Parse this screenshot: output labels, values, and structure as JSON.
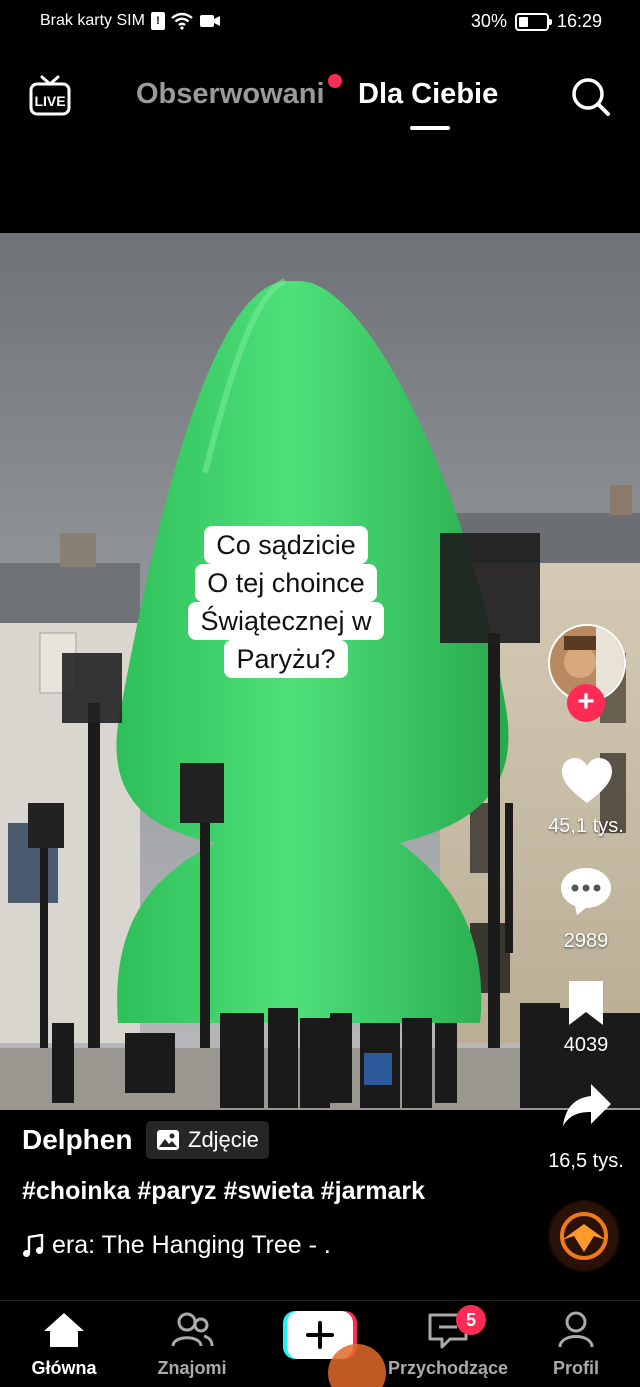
{
  "status_bar": {
    "carrier": "Brak karty SIM",
    "battery": "30%",
    "time": "16:29"
  },
  "top_nav": {
    "live_label": "LIVE",
    "tab_following": "Obserwowani",
    "tab_for_you": "Dla Ciebie"
  },
  "post": {
    "caption_lines": [
      "Co sądzicie",
      "O tej choince",
      "Świątecznej w",
      "Paryżu?"
    ],
    "likes": "45,1 tys.",
    "comments": "2989",
    "saves": "4039",
    "shares": "16,5 tys.",
    "author": "Delphen",
    "type_label": "Zdjęcie",
    "hashtags": "#choinka #paryz #swieta #jarmark",
    "music": "era: The Hanging Tree - ."
  },
  "bottom_nav": {
    "home": "Główna",
    "friends": "Znajomi",
    "create": "+",
    "inbox": "Przychodzące",
    "inbox_badge": "5",
    "profile": "Profil"
  },
  "colors": {
    "accent": "#fe2c55",
    "sculpture_green": "#3fd16a",
    "sky": "#7d8187"
  }
}
